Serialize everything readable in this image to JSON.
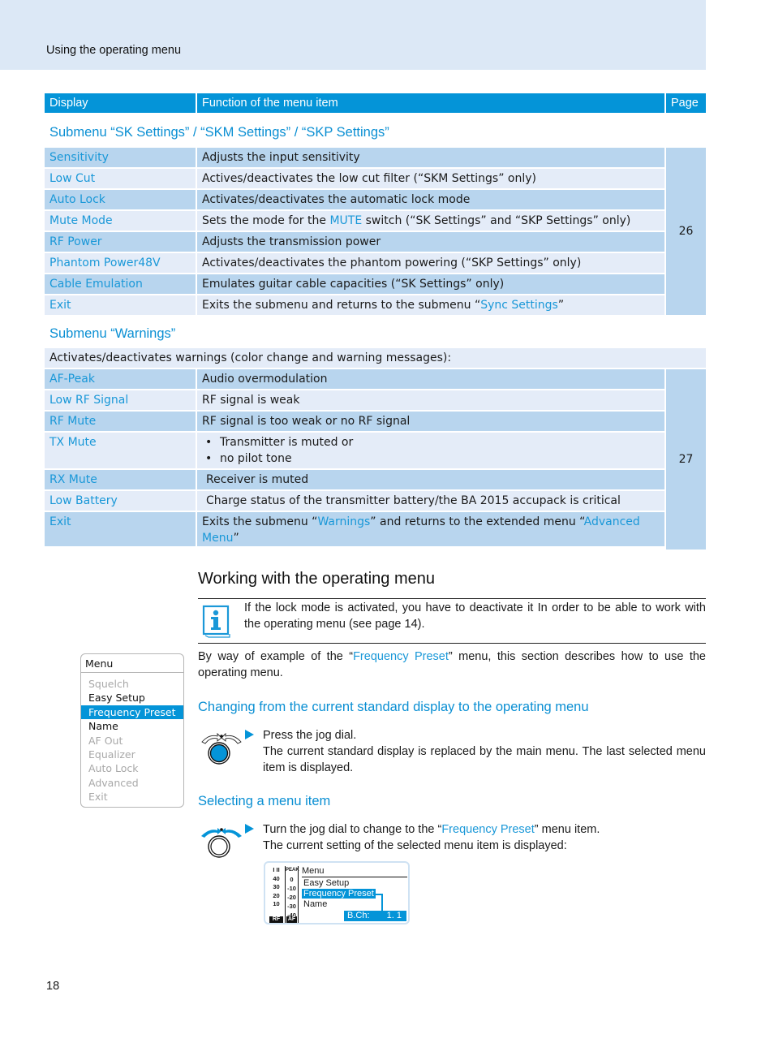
{
  "header": {
    "title": "Using the operating menu"
  },
  "table_header": {
    "display": "Display",
    "function": "Function of the menu item",
    "page": "Page"
  },
  "sk_settings": {
    "title": "Submenu “SK Settings” / “SKM Settings” / “SKP Settings”",
    "page": "26",
    "rows": [
      {
        "display": "Sensitivity",
        "function": "Adjusts the input sensitivity"
      },
      {
        "display": "Low Cut",
        "function": "Actives/deactivates the low cut filter (“SKM Settings” only)"
      },
      {
        "display": "Auto Lock",
        "function": "Activates/deactivates the automatic lock mode"
      },
      {
        "display": "Mute Mode",
        "function_pre": "Sets the mode for the ",
        "function_link": "MUTE",
        "function_post": " switch (“SK Settings” and “SKP Settings” only)"
      },
      {
        "display": "RF Power",
        "function": "Adjusts the transmission power"
      },
      {
        "display": "Phantom Power48V",
        "function": "Activates/deactivates the phantom powering (“SKP Settings” only)"
      },
      {
        "display": "Cable Emulation",
        "function": "Emulates guitar cable capacities (“SK Settings” only)"
      },
      {
        "display": "Exit",
        "function_pre": "Exits the submenu and returns to the submenu “",
        "function_link": "Sync Settings",
        "function_post": "”"
      }
    ]
  },
  "warnings": {
    "title": "Submenu “Warnings”",
    "intro": "Activates/deactivates warnings (color change and warning messages):",
    "page": "27",
    "rows": [
      {
        "display": "AF-Peak",
        "function": "Audio overmodulation"
      },
      {
        "display": "Low RF Signal",
        "function": "RF signal is weak"
      },
      {
        "display": "RF Mute",
        "function": "RF signal is too weak or no RF signal"
      },
      {
        "display": "TX Mute",
        "bullets": [
          "Transmitter is muted or",
          "no pilot tone"
        ]
      },
      {
        "display": "RX Mute",
        "function": "Receiver is muted"
      },
      {
        "display": "Low Battery",
        "function": "Charge status of the transmitter battery/the BA 2015 accupack is critical"
      },
      {
        "display": "Exit",
        "function_pre": "Exits the submenu “",
        "function_link1": "Warnings",
        "function_mid": "” and returns to the extended menu “",
        "function_link2": "Advanced Menu",
        "function_post": "”"
      }
    ]
  },
  "working": {
    "heading": "Working with the operating menu",
    "note": "If the lock mode is activated, you have to deactivate it In order to be able to work with the operating menu (see page 14).",
    "intro_pre": "By way of example of the “",
    "intro_link": "Frequency Preset",
    "intro_post": "” menu, this section describes how to use the operating menu.",
    "section1": {
      "title": "Changing from the current standard display to the operating menu",
      "step": "Press the jog dial.",
      "result": "The current standard display is replaced by the main menu. The last selected menu item is displayed."
    },
    "section2": {
      "title": "Selecting a menu item",
      "step_pre": "Turn the jog dial to change to the “",
      "step_link": "Frequency Preset",
      "step_post": "” menu item.",
      "result": "The current setting of the selected menu item is displayed:"
    }
  },
  "menu_panel": {
    "title": "Menu",
    "items": [
      {
        "label": "Squelch",
        "state": "inactive"
      },
      {
        "label": "Easy Setup",
        "state": "active"
      },
      {
        "label": "Frequency Preset",
        "state": "selected"
      },
      {
        "label": "Name",
        "state": "active"
      },
      {
        "label": "AF Out",
        "state": "inactive"
      },
      {
        "label": "Equalizer",
        "state": "inactive"
      },
      {
        "label": "Auto Lock",
        "state": "inactive"
      },
      {
        "label": "Advanced",
        "state": "inactive"
      },
      {
        "label": "Exit",
        "state": "inactive"
      }
    ]
  },
  "lcd": {
    "rf_header": "I II",
    "rf_scale": [
      "40",
      "30",
      "20",
      "10"
    ],
    "rf_tag": "RF",
    "af_header": "PEAK",
    "af_scale": [
      "0",
      "-10",
      "-20",
      "-30",
      "-40"
    ],
    "af_tag": "AF",
    "menu_title": "Menu",
    "lines": [
      "Easy Setup",
      "Frequency Preset",
      "Name"
    ],
    "value_label": "B.Ch:",
    "value": "1. 1"
  },
  "page_number": "18"
}
